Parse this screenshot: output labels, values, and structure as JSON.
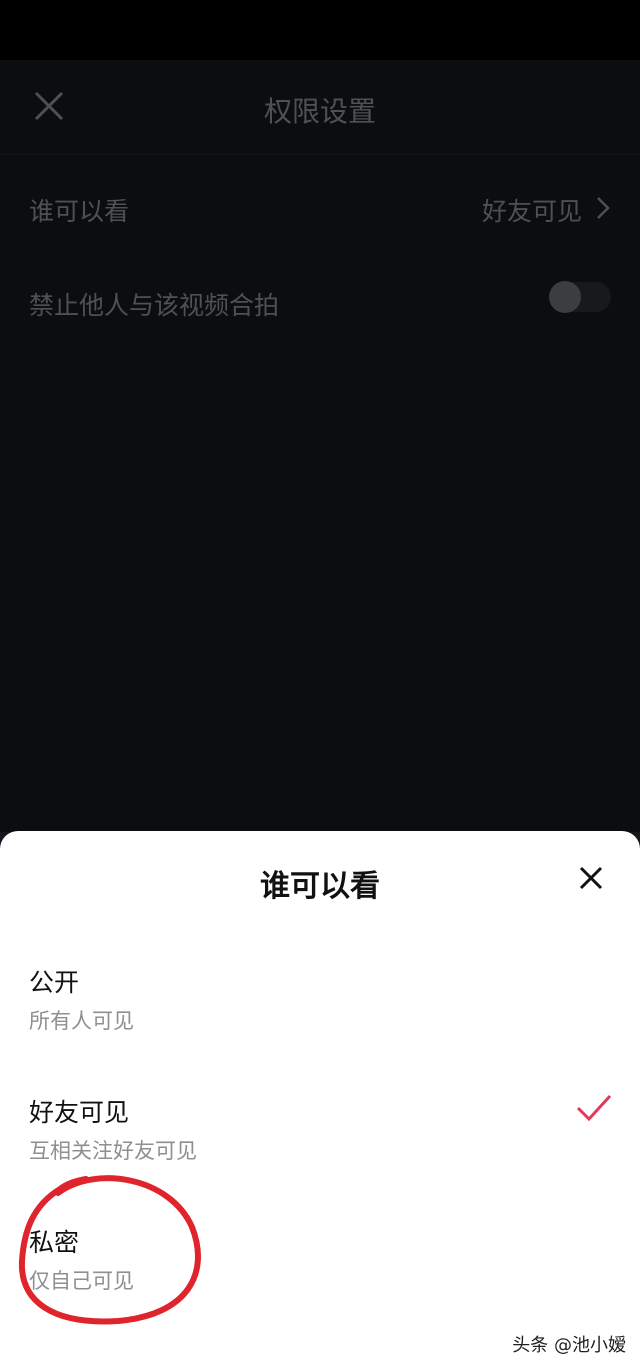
{
  "header": {
    "title": "权限设置",
    "close_icon": "close-icon"
  },
  "settings": {
    "visibility": {
      "label": "谁可以看",
      "value": "好友可见"
    },
    "duet": {
      "label": "禁止他人与该视频合拍",
      "enabled": false
    }
  },
  "sheet": {
    "title": "谁可以看",
    "options": [
      {
        "title": "公开",
        "subtitle": "所有人可见",
        "selected": false
      },
      {
        "title": "好友可见",
        "subtitle": "互相关注好友可见",
        "selected": true
      },
      {
        "title": "私密",
        "subtitle": "仅自己可见",
        "selected": false
      }
    ],
    "accent": "#e0395c"
  },
  "annotation": {
    "color": "#e0242c"
  },
  "watermark": "头条 @池小嫒"
}
